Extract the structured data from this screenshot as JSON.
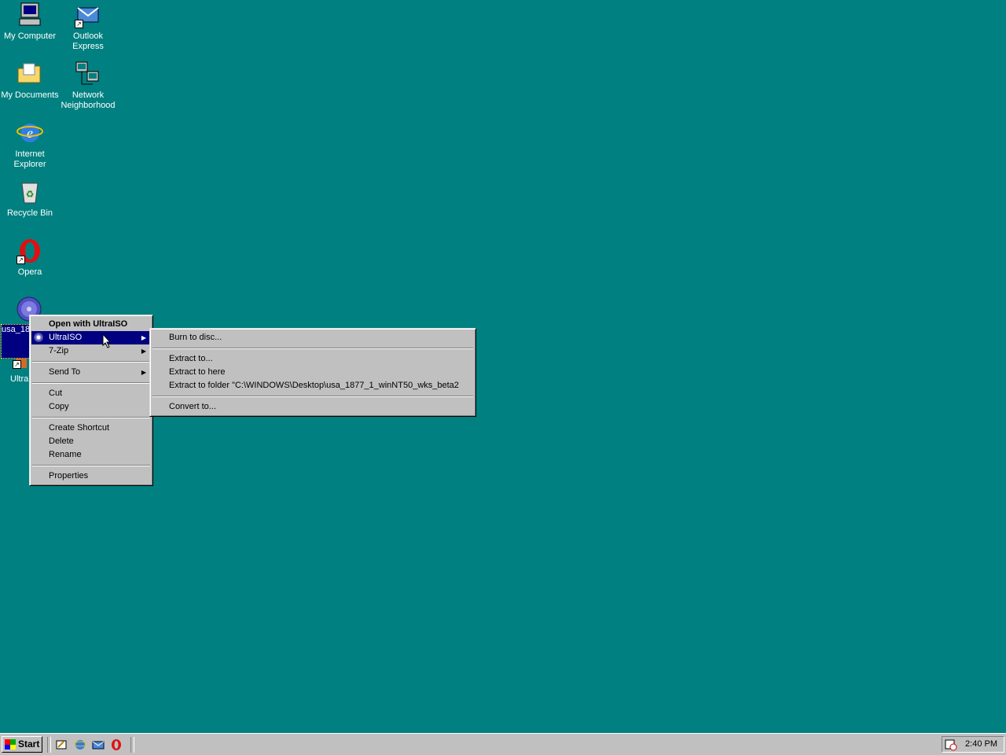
{
  "desktop": {
    "icons": [
      {
        "label": "My Computer",
        "icon": "my-computer-icon"
      },
      {
        "label": "Outlook Express",
        "icon": "outlook-express-icon"
      },
      {
        "label": "My Documents",
        "icon": "my-documents-icon"
      },
      {
        "label": "Network Neighborhood",
        "icon": "network-neighborhood-icon"
      },
      {
        "label": "Internet Explorer",
        "icon": "internet-explorer-icon"
      },
      {
        "label": "Recycle Bin",
        "icon": "recycle-bin-icon"
      },
      {
        "label": "Opera",
        "icon": "opera-icon"
      }
    ],
    "selected_file_label": "usa_1877_1_winNT50_wks_beta2",
    "ultraiso_shortcut_label": "UltraISO"
  },
  "context_menu": {
    "items": [
      {
        "label": "Open with UltraISO"
      },
      {
        "label": "UltraISO"
      },
      {
        "label": "7-Zip"
      },
      {
        "label": "Send To"
      },
      {
        "label": "Cut"
      },
      {
        "label": "Copy"
      },
      {
        "label": "Create Shortcut"
      },
      {
        "label": "Delete"
      },
      {
        "label": "Rename"
      },
      {
        "label": "Properties"
      }
    ]
  },
  "submenu": {
    "items": [
      {
        "label": "Burn to disc..."
      },
      {
        "label": "Extract to..."
      },
      {
        "label": "Extract to here"
      },
      {
        "label": "Extract to folder \"C:\\WINDOWS\\Desktop\\usa_1877_1_winNT50_wks_beta2"
      },
      {
        "label": "Convert to..."
      }
    ]
  },
  "taskbar": {
    "start_label": "Start",
    "quick_launch": [
      "show-desktop-icon",
      "ie-launch-icon",
      "outlook-launch-icon",
      "opera-launch-icon"
    ],
    "clock": "2:40 PM"
  },
  "colors": {
    "desktop": "#008080",
    "menu_face": "#c0c0c0",
    "highlight": "#000080"
  }
}
